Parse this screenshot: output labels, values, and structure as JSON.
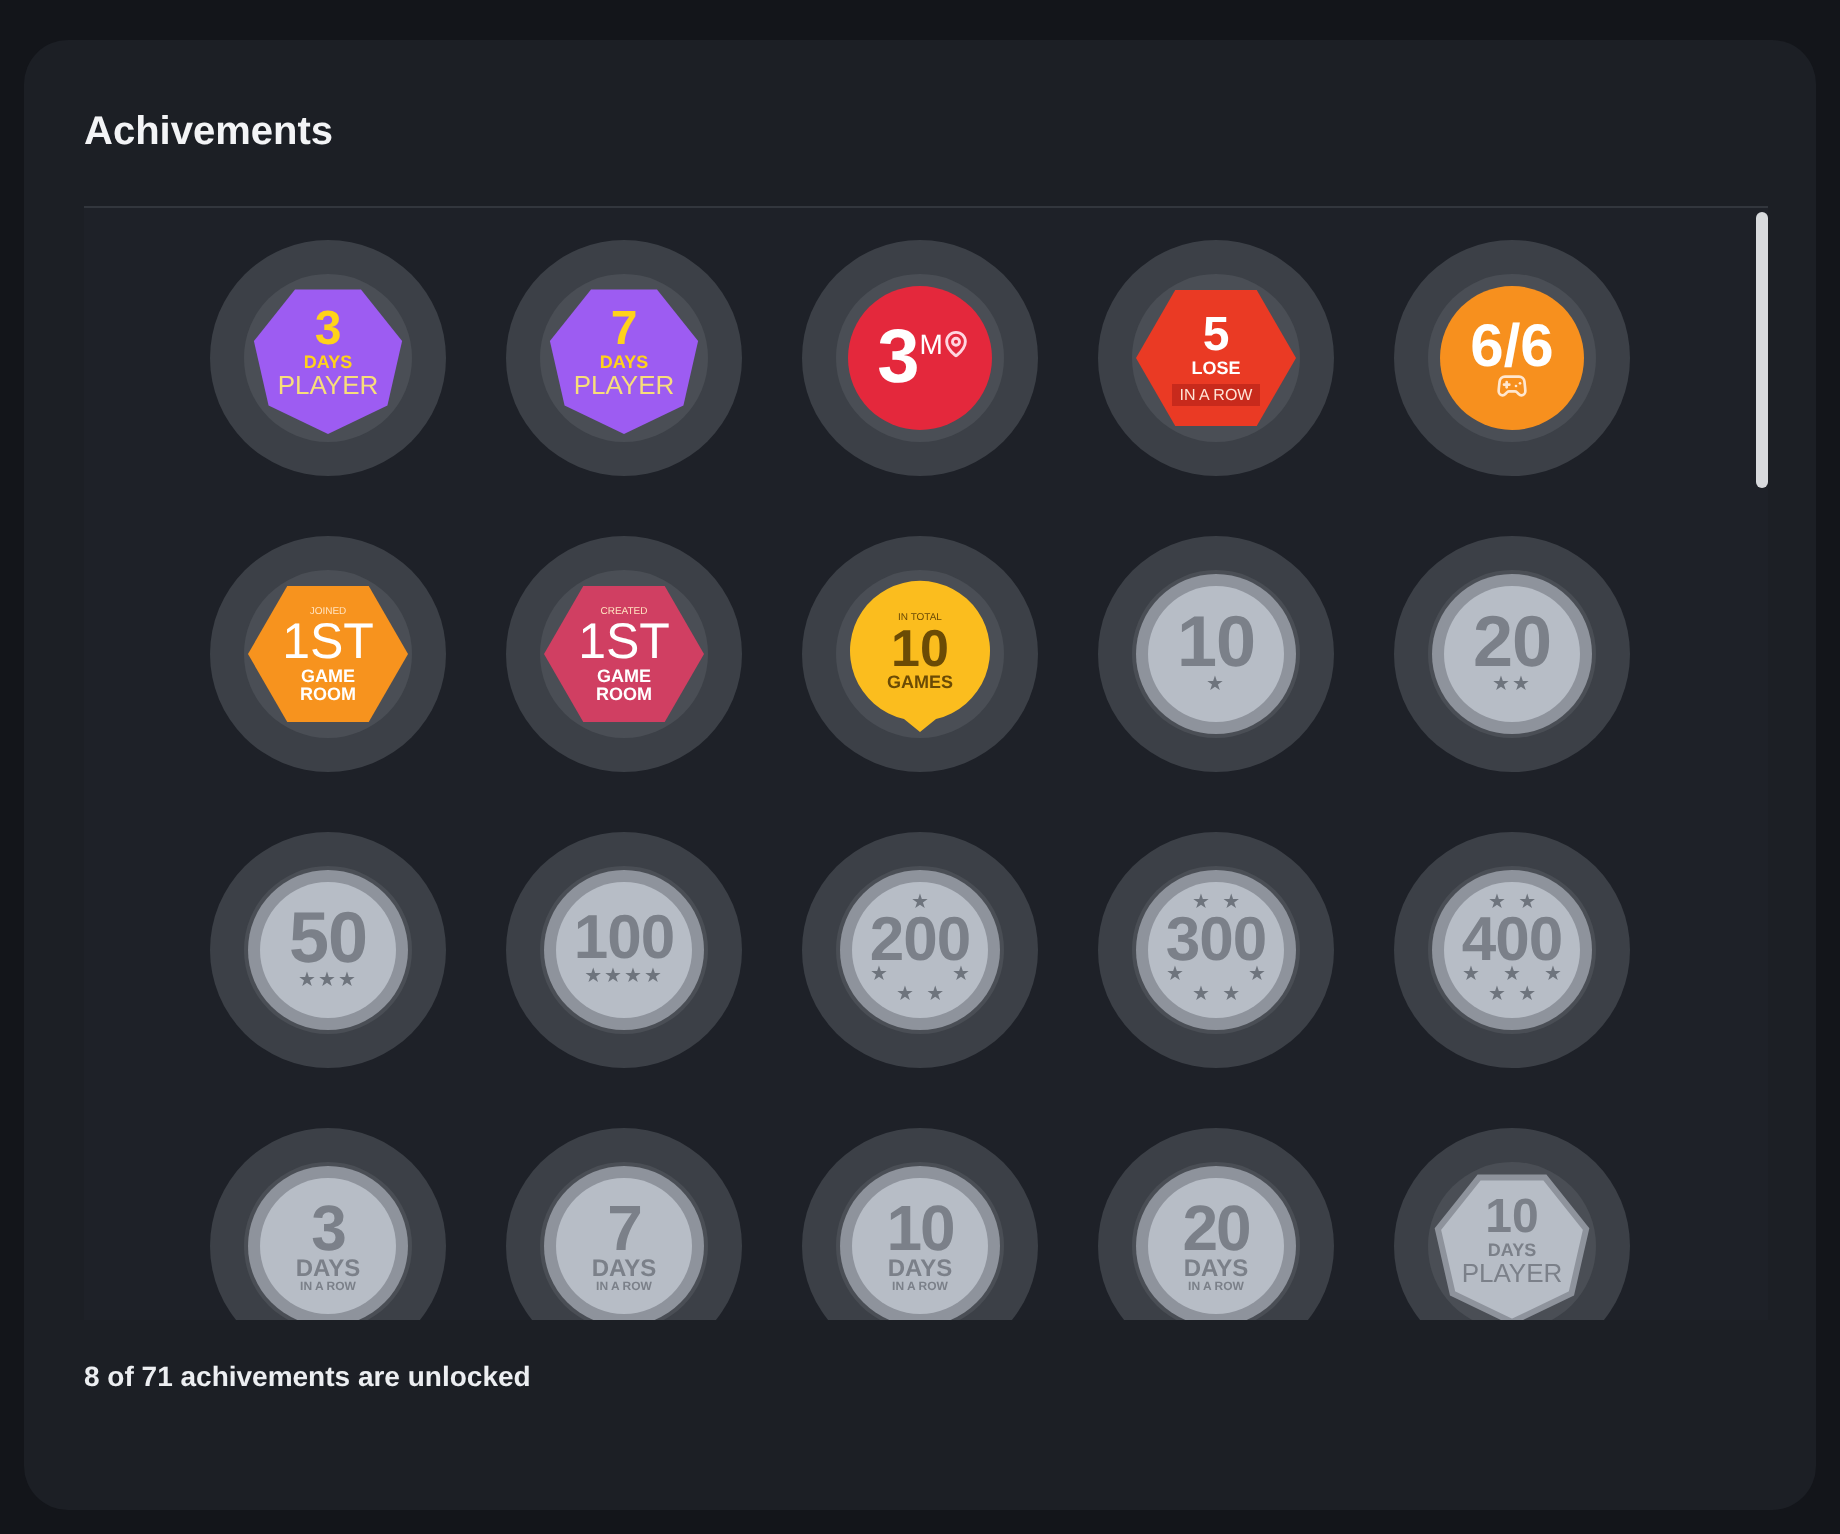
{
  "title": "Achivements",
  "badges": [
    {
      "kind": "player",
      "unlocked": true,
      "color": "#9d5cf2",
      "value": "3",
      "unit": "DAYS",
      "caption": "PLAYER"
    },
    {
      "kind": "player",
      "unlocked": true,
      "color": "#9d5cf2",
      "value": "7",
      "unit": "DAYS",
      "caption": "PLAYER"
    },
    {
      "kind": "location",
      "unlocked": true,
      "color": "#e4283c",
      "value": "3",
      "unit": "M"
    },
    {
      "kind": "streak",
      "unlocked": true,
      "color": "#ea3a24",
      "value": "5",
      "unit": "LOSE",
      "caption": "IN A ROW"
    },
    {
      "kind": "gamepad",
      "unlocked": true,
      "color": "#f7901e",
      "value": "6/6"
    },
    {
      "kind": "room",
      "unlocked": true,
      "color": "#f7931e",
      "top": "JOINED",
      "value": "1ST",
      "caption": "GAME ROOM"
    },
    {
      "kind": "room",
      "unlocked": true,
      "color": "#d03f62",
      "top": "CREATED",
      "value": "1ST",
      "caption": "GAME ROOM"
    },
    {
      "kind": "games",
      "unlocked": true,
      "color": "#fbbd1e",
      "top": "IN TOTAL",
      "value": "10",
      "caption": "GAMES"
    },
    {
      "kind": "medal",
      "unlocked": false,
      "value": "10",
      "stars_below": [
        "★"
      ]
    },
    {
      "kind": "medal",
      "unlocked": false,
      "value": "20",
      "stars_below": [
        "★★"
      ]
    },
    {
      "kind": "medal",
      "unlocked": false,
      "value": "50",
      "stars_below": [
        "★★★"
      ]
    },
    {
      "kind": "medal",
      "unlocked": false,
      "value": "100",
      "stars_below": [
        "★★★★"
      ]
    },
    {
      "kind": "medal",
      "unlocked": false,
      "value": "200",
      "stars_above": "★",
      "stars_below": [
        "★ ★",
        "★ ★"
      ]
    },
    {
      "kind": "medal",
      "unlocked": false,
      "value": "300",
      "stars_above": "★ ★",
      "stars_below": [
        "★ ★",
        "★ ★"
      ]
    },
    {
      "kind": "medal",
      "unlocked": false,
      "value": "400",
      "stars_above": "★ ★",
      "stars_below": [
        "★ ★ ★",
        "★ ★"
      ]
    },
    {
      "kind": "days",
      "unlocked": false,
      "value": "3",
      "unit": "DAYS",
      "caption": "IN A ROW"
    },
    {
      "kind": "days",
      "unlocked": false,
      "value": "7",
      "unit": "DAYS",
      "caption": "IN A ROW"
    },
    {
      "kind": "days",
      "unlocked": false,
      "value": "10",
      "unit": "DAYS",
      "caption": "IN A ROW"
    },
    {
      "kind": "days",
      "unlocked": false,
      "value": "20",
      "unit": "DAYS",
      "caption": "IN A ROW"
    },
    {
      "kind": "player",
      "unlocked": false,
      "value": "10",
      "unit": "DAYS",
      "caption": "PLAYER"
    }
  ],
  "footer": "8 of 71 achivements are unlocked"
}
